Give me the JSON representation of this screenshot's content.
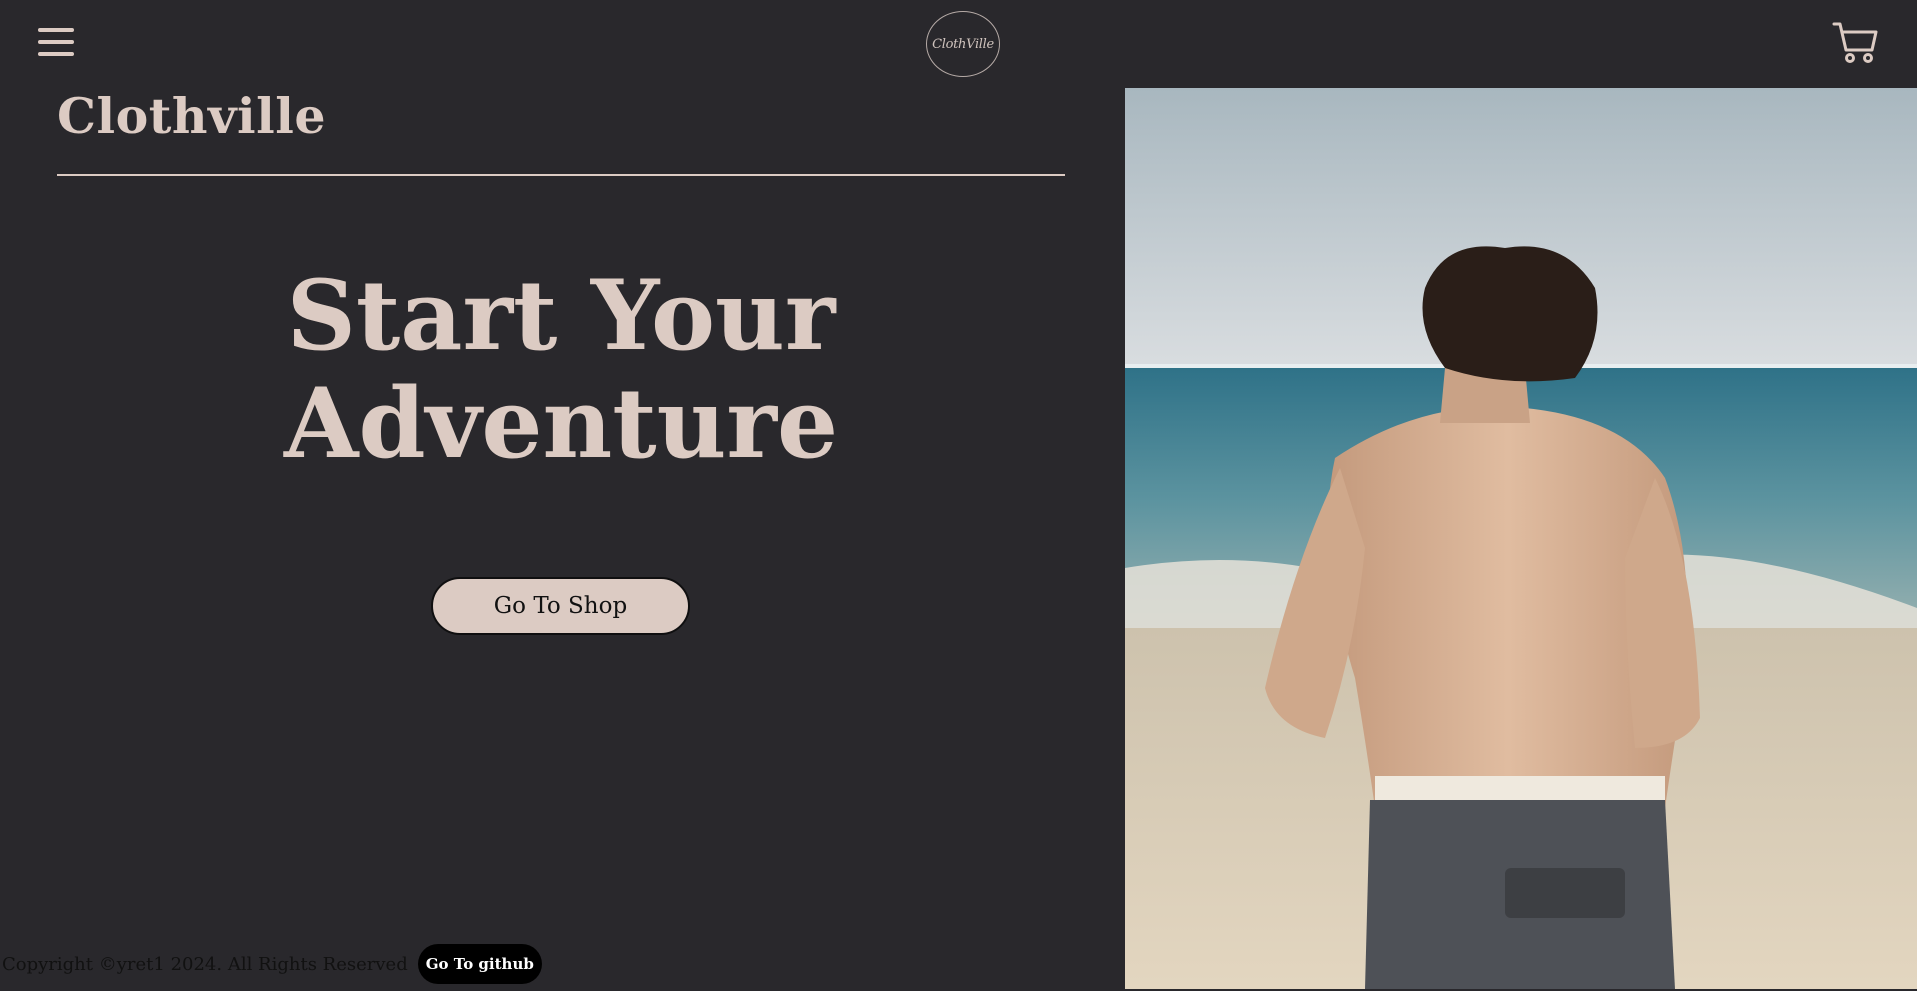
{
  "header": {
    "menu_icon": "hamburger-menu-icon",
    "logo_text": "ClothVille",
    "cart_icon": "shopping-cart-icon"
  },
  "brand": {
    "name": "Clothville"
  },
  "hero": {
    "title_line1": "Start Your",
    "title_line2": "Adventure",
    "cta_label": "Go To Shop",
    "image_description_icon": "beach-photo"
  },
  "footer": {
    "copyright": "Copyright ©yret1 2024. All Rights Reserved",
    "github_label": "Go To github"
  },
  "colors": {
    "background": "#29282c",
    "accent": "#dccbc3",
    "button_text": "#111111",
    "github_bg": "#000000"
  }
}
